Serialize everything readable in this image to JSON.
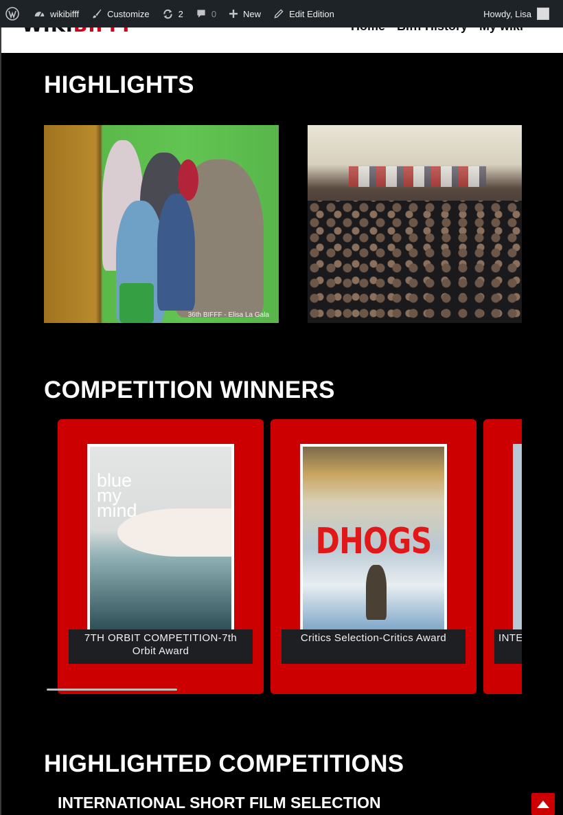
{
  "adminbar": {
    "site_name": "wikibifff",
    "customize": "Customize",
    "updates_count": "2",
    "comments_count": "0",
    "new": "New",
    "edit": "Edit Edition",
    "howdy": "Howdy, Lisa"
  },
  "header": {
    "logo_wiki": "WIKI",
    "logo_bifff": "BIFFF",
    "nav": [
      "Home",
      "Bifff History",
      "My wiki"
    ]
  },
  "highlights": {
    "title": "HIGHLIGHTS",
    "photo1_credit": "36th BIFFF - Elisa La Gala"
  },
  "winners": {
    "title": "COMPETITION WINNERS",
    "cards": [
      {
        "label": "7TH ORBIT COMPETITION-7th Orbit Award",
        "poster_title": "blue my mind",
        "poster_top": "blue my mind"
      },
      {
        "label": "Critics Selection-Critics Award",
        "poster_title": "DHOGS"
      },
      {
        "label": "INTERNATIONAL"
      }
    ]
  },
  "competitions": {
    "title": "HIGHLIGHTED COMPETITIONS",
    "first": "INTERNATIONAL SHORT FILM SELECTION"
  },
  "colors": {
    "brand_red": "#cc0001",
    "admin_bar": "#1d2327",
    "background": "#000000"
  }
}
